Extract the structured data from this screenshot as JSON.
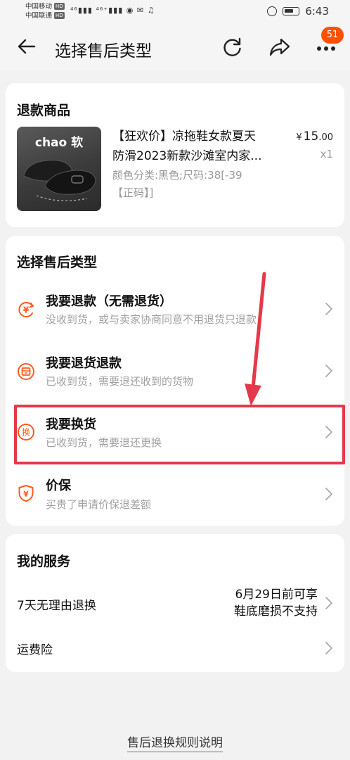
{
  "status_bar": {
    "carrier1": "中国移动",
    "carrier2": "中国联通",
    "hd": "HD",
    "network": "⁴⁶ᴵ ⁴⁶⁺ᴵ",
    "time": "6:43"
  },
  "nav": {
    "title": "选择售后类型",
    "badge": "51"
  },
  "product_section": {
    "title": "退款商品",
    "image_brand": "chao 软",
    "name_line1": "【狂欢价】凉拖鞋女款夏天",
    "name_line2": "防滑2023新款沙滩室内家...",
    "price_symbol": "¥",
    "price_int": "15",
    "price_dec": ".00",
    "quantity": "x1",
    "spec_line1": "颜色分类:黑色;尺码:38[-39",
    "spec_line2": "【正码】]"
  },
  "types_section": {
    "title": "选择售后类型",
    "items": [
      {
        "title": "我要退款（无需退货）",
        "desc": "没收到货，或与卖家协商同意不用退货只退款",
        "icon": "yen-refund-icon"
      },
      {
        "title": "我要退货退款",
        "desc": "已收到货，需要退还收到的货物",
        "icon": "return-box-icon"
      },
      {
        "title": "我要换货",
        "desc": "已收到货，需要退还更换",
        "icon": "exchange-icon"
      },
      {
        "title": "价保",
        "desc": "买贵了申请价保退差额",
        "icon": "price-protect-shield-icon"
      }
    ]
  },
  "services_section": {
    "title": "我的服务",
    "rows": [
      {
        "label": "7天无理由退换",
        "value_line1": "6月29日前可享",
        "value_line2": "鞋底磨损不支持"
      },
      {
        "label": "运费险",
        "value_line1": "",
        "value_line2": ""
      }
    ]
  },
  "footer": {
    "link": "售后退换规则说明"
  },
  "colors": {
    "accent": "#ff5000",
    "annotation": "#e5384a",
    "icon_orange": "#ff5a1f"
  }
}
